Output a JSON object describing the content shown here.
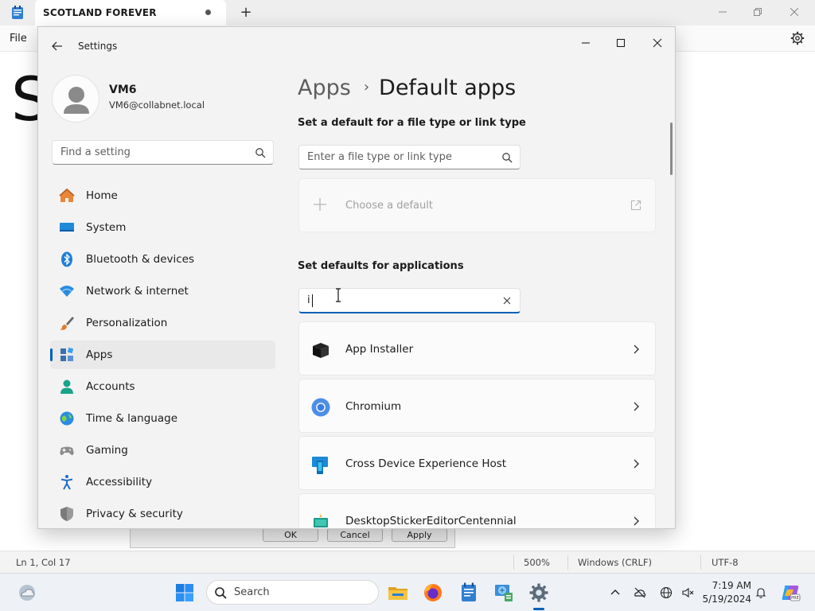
{
  "notepad": {
    "tab_title": "SCOTLAND FOREVER",
    "new_tab": "+",
    "menu_file": "File",
    "body_text": "S",
    "status": {
      "position": "Ln 1, Col 17",
      "zoom": "500%",
      "line_endings": "Windows (CRLF)",
      "encoding": "UTF-8"
    }
  },
  "dialog": {
    "ok": "OK",
    "cancel": "Cancel",
    "apply": "Apply"
  },
  "settings": {
    "window_title": "Settings",
    "user": {
      "name": "VM6",
      "email": "VM6@collabnet.local"
    },
    "find_placeholder": "Find a setting",
    "nav": [
      {
        "label": "Home",
        "icon": "home-icon"
      },
      {
        "label": "System",
        "icon": "system-icon"
      },
      {
        "label": "Bluetooth & devices",
        "icon": "bluetooth-icon"
      },
      {
        "label": "Network & internet",
        "icon": "network-icon"
      },
      {
        "label": "Personalization",
        "icon": "brush-icon"
      },
      {
        "label": "Apps",
        "icon": "apps-icon",
        "active": true
      },
      {
        "label": "Accounts",
        "icon": "accounts-icon"
      },
      {
        "label": "Time & language",
        "icon": "globe-icon"
      },
      {
        "label": "Gaming",
        "icon": "gamepad-icon"
      },
      {
        "label": "Accessibility",
        "icon": "accessibility-icon"
      },
      {
        "label": "Privacy & security",
        "icon": "shield-icon"
      }
    ],
    "breadcrumb": {
      "parent": "Apps",
      "separator": "›",
      "current": "Default apps"
    },
    "filetype_section": {
      "title": "Set a default for a file type or link type",
      "placeholder": "Enter a file type or link type",
      "choose_default": "Choose a default"
    },
    "apps_section": {
      "title": "Set defaults for applications",
      "search_value": "i"
    },
    "apps": [
      {
        "name": "App Installer",
        "icon": "app-installer-icon"
      },
      {
        "name": "Chromium",
        "icon": "chromium-icon"
      },
      {
        "name": "Cross Device Experience Host",
        "icon": "cross-device-icon"
      },
      {
        "name": "DesktopStickerEditorCentennial",
        "icon": "sticker-editor-icon"
      }
    ]
  },
  "taskbar": {
    "search_placeholder": "Search",
    "time": "7:19 AM",
    "date": "5/19/2024"
  },
  "colors": {
    "accent": "#005fb8",
    "window_bg": "#f3f3f3",
    "card_bg": "#fbfbfb"
  }
}
